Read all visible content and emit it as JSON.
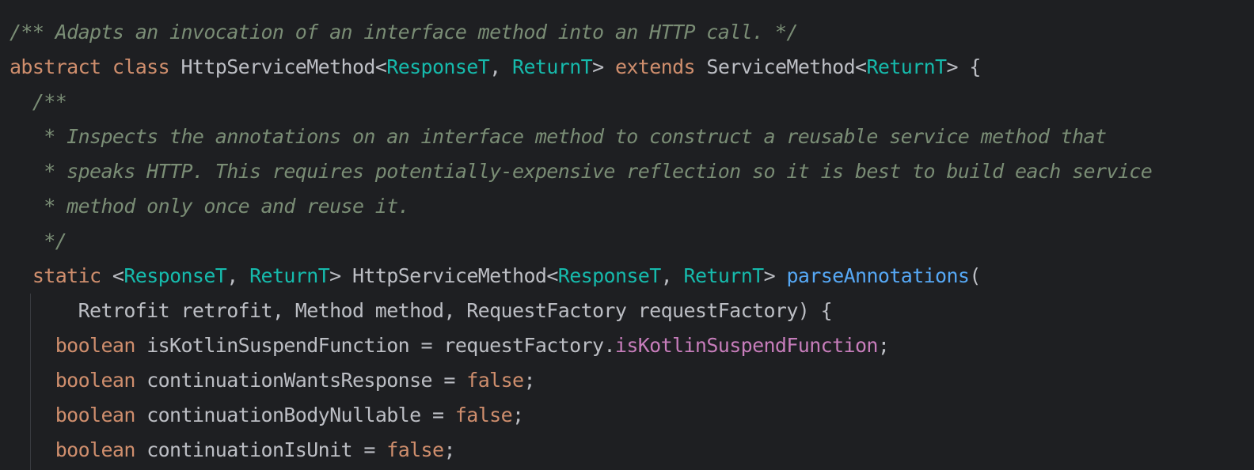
{
  "theme": {
    "background": "#1e1f22",
    "default_text": "#bcbec4",
    "comment": "#7a8d75",
    "keyword": "#cf8e6d",
    "type_parameter": "#16baac",
    "method_declaration": "#56a8f5",
    "field_reference": "#c77dbb",
    "indent_guide": "#393b40"
  },
  "code_lines": [
    [
      {
        "t": "/** Adapts an invocation of an interface method into an HTTP call. */",
        "k": "comment"
      }
    ],
    [
      {
        "t": "abstract",
        "k": "keyword"
      },
      {
        "t": " ",
        "k": "plain"
      },
      {
        "t": "class",
        "k": "keyword"
      },
      {
        "t": " HttpServiceMethod<",
        "k": "plain"
      },
      {
        "t": "ResponseT",
        "k": "typeparam"
      },
      {
        "t": ", ",
        "k": "plain"
      },
      {
        "t": "ReturnT",
        "k": "typeparam"
      },
      {
        "t": "> ",
        "k": "plain"
      },
      {
        "t": "extends",
        "k": "keyword"
      },
      {
        "t": " ServiceMethod<",
        "k": "plain"
      },
      {
        "t": "ReturnT",
        "k": "typeparam"
      },
      {
        "t": "> {",
        "k": "plain"
      }
    ],
    [
      {
        "t": "  /**",
        "k": "comment"
      }
    ],
    [
      {
        "t": "   * Inspects the annotations on an interface method to construct a reusable service method that",
        "k": "comment"
      }
    ],
    [
      {
        "t": "   * speaks HTTP. This requires potentially-expensive reflection so it is best to build each service",
        "k": "comment"
      }
    ],
    [
      {
        "t": "   * method only once and reuse it.",
        "k": "comment"
      }
    ],
    [
      {
        "t": "   */",
        "k": "comment"
      }
    ],
    [
      {
        "t": "  ",
        "k": "plain"
      },
      {
        "t": "static",
        "k": "keyword"
      },
      {
        "t": " <",
        "k": "plain"
      },
      {
        "t": "ResponseT",
        "k": "typeparam"
      },
      {
        "t": ", ",
        "k": "plain"
      },
      {
        "t": "ReturnT",
        "k": "typeparam"
      },
      {
        "t": "> HttpServiceMethod<",
        "k": "plain"
      },
      {
        "t": "ResponseT",
        "k": "typeparam"
      },
      {
        "t": ", ",
        "k": "plain"
      },
      {
        "t": "ReturnT",
        "k": "typeparam"
      },
      {
        "t": "> ",
        "k": "plain"
      },
      {
        "t": "parseAnnotations",
        "k": "method"
      },
      {
        "t": "(",
        "k": "plain"
      }
    ],
    [
      {
        "t": "      Retrofit retrofit, Method method, RequestFactory requestFactory) {",
        "k": "plain"
      }
    ],
    [
      {
        "t": "    ",
        "k": "plain"
      },
      {
        "t": "boolean",
        "k": "keyword"
      },
      {
        "t": " isKotlinSuspendFunction = requestFactory.",
        "k": "plain"
      },
      {
        "t": "isKotlinSuspendFunction",
        "k": "field"
      },
      {
        "t": ";",
        "k": "plain"
      }
    ],
    [
      {
        "t": "    ",
        "k": "plain"
      },
      {
        "t": "boolean",
        "k": "keyword"
      },
      {
        "t": " continuationWantsResponse = ",
        "k": "plain"
      },
      {
        "t": "false",
        "k": "keyword"
      },
      {
        "t": ";",
        "k": "plain"
      }
    ],
    [
      {
        "t": "    ",
        "k": "plain"
      },
      {
        "t": "boolean",
        "k": "keyword"
      },
      {
        "t": " continuationBodyNullable = ",
        "k": "plain"
      },
      {
        "t": "false",
        "k": "keyword"
      },
      {
        "t": ";",
        "k": "plain"
      }
    ],
    [
      {
        "t": "    ",
        "k": "plain"
      },
      {
        "t": "boolean",
        "k": "keyword"
      },
      {
        "t": " continuationIsUnit = ",
        "k": "plain"
      },
      {
        "t": "false",
        "k": "keyword"
      },
      {
        "t": ";",
        "k": "plain"
      }
    ]
  ]
}
